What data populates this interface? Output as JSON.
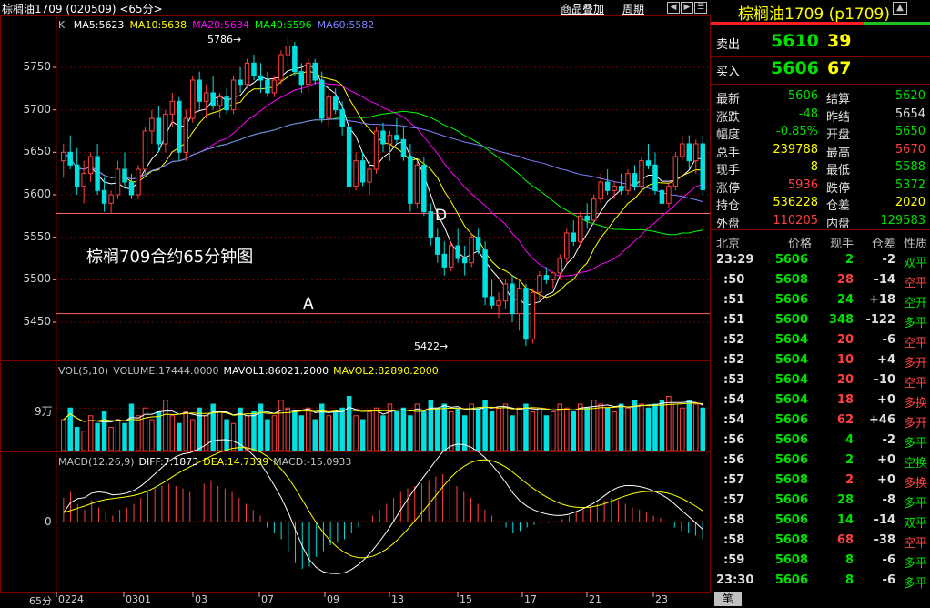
{
  "window": {
    "title": "棕榈油1709 (020509) <65分>",
    "menu_overlay": "商品叠加",
    "menu_period": "周期"
  },
  "main": {
    "k_label": "K",
    "ma_legend": [
      {
        "text": "MA5:5623",
        "color": "#ffffff"
      },
      {
        "text": "MA10:5638",
        "color": "#ffff00"
      },
      {
        "text": "MA20:5634",
        "color": "#ff00ff"
      },
      {
        "text": "MA40:5596",
        "color": "#00ff00"
      },
      {
        "text": "MA60:5582",
        "color": "#8080ff"
      }
    ],
    "annotation_title": "棕榈709合约65分钟图",
    "label_d": "D",
    "label_a": "A",
    "high_label": "5786",
    "low_label": "5422",
    "period_label": "65分"
  },
  "volume": {
    "legend": [
      {
        "text": "VOL(5,10)",
        "color": "#c0c0c0"
      },
      {
        "text": "VOLUME:17444.0000",
        "color": "#c0c0c0"
      },
      {
        "text": "MAVOL1:86021.2000",
        "color": "#ffffff"
      },
      {
        "text": "MAVOL2:82890.2000",
        "color": "#ffff00"
      }
    ],
    "axis_label": "9万"
  },
  "macd": {
    "legend": [
      {
        "text": "MACD(12,26,9)",
        "color": "#c0c0c0"
      },
      {
        "text": "DIFF:7.1873",
        "color": "#ffffff"
      },
      {
        "text": "DEA:14.7339",
        "color": "#ffff00"
      },
      {
        "text": "MACD:-15.0933",
        "color": "#c0c0c0"
      }
    ],
    "axis_label": "0"
  },
  "colors": {
    "up": "#ff4040",
    "down": "#00e0e0",
    "grid": "#800000",
    "hline": "#ff6060"
  },
  "chart_data": {
    "type": "candlestick",
    "y_axis": {
      "ticks": [
        "5750",
        "5700",
        "5650",
        "5600",
        "5550",
        "5500",
        "5450"
      ],
      "ylim": [
        5405,
        5810
      ]
    },
    "x_axis": {
      "ticks": [
        "0224",
        "0301",
        "03",
        "07",
        "09",
        "13",
        "15",
        "17",
        "21",
        "23"
      ]
    },
    "horizontal_lines": [
      5578,
      5460
    ],
    "candles": [
      [
        5640,
        5660,
        5620,
        5650
      ],
      [
        5650,
        5670,
        5630,
        5635
      ],
      [
        5635,
        5655,
        5600,
        5610
      ],
      [
        5610,
        5640,
        5590,
        5625
      ],
      [
        5625,
        5650,
        5615,
        5645
      ],
      [
        5645,
        5660,
        5600,
        5605
      ],
      [
        5605,
        5620,
        5580,
        5590
      ],
      [
        5590,
        5605,
        5578,
        5600
      ],
      [
        5600,
        5640,
        5595,
        5630
      ],
      [
        5630,
        5650,
        5610,
        5615
      ],
      [
        5615,
        5625,
        5595,
        5600
      ],
      [
        5600,
        5635,
        5595,
        5630
      ],
      [
        5630,
        5680,
        5625,
        5675
      ],
      [
        5675,
        5700,
        5660,
        5690
      ],
      [
        5690,
        5705,
        5650,
        5660
      ],
      [
        5660,
        5700,
        5650,
        5695
      ],
      [
        5695,
        5720,
        5680,
        5710
      ],
      [
        5710,
        5715,
        5640,
        5650
      ],
      [
        5650,
        5700,
        5640,
        5690
      ],
      [
        5690,
        5740,
        5685,
        5735
      ],
      [
        5735,
        5745,
        5700,
        5710
      ],
      [
        5710,
        5730,
        5690,
        5720
      ],
      [
        5720,
        5740,
        5700,
        5705
      ],
      [
        5705,
        5720,
        5690,
        5715
      ],
      [
        5715,
        5725,
        5695,
        5700
      ],
      [
        5700,
        5740,
        5695,
        5735
      ],
      [
        5735,
        5750,
        5720,
        5730
      ],
      [
        5730,
        5760,
        5725,
        5755
      ],
      [
        5755,
        5765,
        5735,
        5740
      ],
      [
        5740,
        5755,
        5720,
        5735
      ],
      [
        5735,
        5745,
        5715,
        5720
      ],
      [
        5720,
        5740,
        5715,
        5735
      ],
      [
        5735,
        5770,
        5730,
        5765
      ],
      [
        5765,
        5786,
        5750,
        5775
      ],
      [
        5775,
        5780,
        5740,
        5745
      ],
      [
        5745,
        5755,
        5720,
        5730
      ],
      [
        5730,
        5760,
        5720,
        5755
      ],
      [
        5755,
        5760,
        5730,
        5735
      ],
      [
        5735,
        5745,
        5685,
        5690
      ],
      [
        5690,
        5720,
        5680,
        5715
      ],
      [
        5715,
        5725,
        5695,
        5700
      ],
      [
        5700,
        5710,
        5670,
        5680
      ],
      [
        5680,
        5690,
        5600,
        5610
      ],
      [
        5610,
        5650,
        5605,
        5640
      ],
      [
        5640,
        5650,
        5610,
        5615
      ],
      [
        5615,
        5640,
        5600,
        5630
      ],
      [
        5630,
        5680,
        5625,
        5675
      ],
      [
        5675,
        5685,
        5650,
        5660
      ],
      [
        5660,
        5675,
        5640,
        5670
      ],
      [
        5670,
        5690,
        5660,
        5665
      ],
      [
        5665,
        5680,
        5640,
        5645
      ],
      [
        5645,
        5660,
        5580,
        5590
      ],
      [
        5590,
        5640,
        5585,
        5635
      ],
      [
        5635,
        5645,
        5575,
        5580
      ],
      [
        5580,
        5590,
        5540,
        5550
      ],
      [
        5550,
        5560,
        5520,
        5530
      ],
      [
        5530,
        5545,
        5505,
        5515
      ],
      [
        5515,
        5545,
        5510,
        5540
      ],
      [
        5540,
        5560,
        5520,
        5525
      ],
      [
        5525,
        5540,
        5505,
        5520
      ],
      [
        5520,
        5555,
        5515,
        5550
      ],
      [
        5550,
        5560,
        5530,
        5535
      ],
      [
        5535,
        5545,
        5470,
        5480
      ],
      [
        5480,
        5500,
        5465,
        5470
      ],
      [
        5470,
        5485,
        5455,
        5475
      ],
      [
        5475,
        5500,
        5465,
        5495
      ],
      [
        5495,
        5505,
        5450,
        5460
      ],
      [
        5460,
        5500,
        5440,
        5490
      ],
      [
        5490,
        5495,
        5422,
        5430
      ],
      [
        5430,
        5490,
        5425,
        5485
      ],
      [
        5485,
        5510,
        5475,
        5505
      ],
      [
        5505,
        5515,
        5495,
        5500
      ],
      [
        5500,
        5510,
        5490,
        5508
      ],
      [
        5508,
        5530,
        5500,
        5525
      ],
      [
        5525,
        5560,
        5520,
        5555
      ],
      [
        5555,
        5570,
        5540,
        5545
      ],
      [
        5545,
        5580,
        5540,
        5575
      ],
      [
        5575,
        5590,
        5560,
        5570
      ],
      [
        5570,
        5600,
        5565,
        5595
      ],
      [
        5595,
        5625,
        5590,
        5615
      ],
      [
        5615,
        5630,
        5600,
        5605
      ],
      [
        5605,
        5615,
        5595,
        5610
      ],
      [
        5610,
        5625,
        5600,
        5605
      ],
      [
        5605,
        5630,
        5600,
        5625
      ],
      [
        5625,
        5635,
        5605,
        5610
      ],
      [
        5610,
        5645,
        5605,
        5640
      ],
      [
        5640,
        5660,
        5630,
        5635
      ],
      [
        5635,
        5650,
        5600,
        5605
      ],
      [
        5605,
        5620,
        5580,
        5590
      ],
      [
        5590,
        5615,
        5585,
        5610
      ],
      [
        5610,
        5650,
        5605,
        5645
      ],
      [
        5645,
        5670,
        5640,
        5660
      ],
      [
        5660,
        5670,
        5630,
        5640
      ],
      [
        5640,
        5665,
        5625,
        5660
      ],
      [
        5660,
        5670,
        5600,
        5606
      ]
    ],
    "volume": [
      40,
      55,
      30,
      25,
      45,
      35,
      50,
      30,
      40,
      35,
      60,
      45,
      55,
      40,
      50,
      65,
      45,
      35,
      50,
      40,
      55,
      45,
      60,
      50,
      40,
      35,
      55,
      45,
      50,
      60,
      40,
      45,
      65,
      55,
      50,
      45,
      55,
      40,
      60,
      45,
      50,
      55,
      70,
      45,
      40,
      50,
      55,
      45,
      60,
      50,
      55,
      45,
      60,
      50,
      65,
      55,
      60,
      50,
      55,
      45,
      60,
      55,
      65,
      50,
      55,
      60,
      45,
      55,
      60,
      50,
      55,
      45,
      50,
      60,
      55,
      50,
      60,
      55,
      65,
      60,
      55,
      50,
      60,
      55,
      65,
      60,
      55,
      60,
      65,
      70,
      60,
      55,
      65,
      60,
      55,
      70,
      60,
      65,
      80,
      30
    ],
    "macd_hist": [
      20,
      25,
      15,
      10,
      18,
      12,
      8,
      5,
      10,
      12,
      15,
      20,
      25,
      28,
      30,
      32,
      30,
      28,
      25,
      30,
      32,
      35,
      30,
      28,
      25,
      20,
      15,
      10,
      5,
      -5,
      -10,
      -15,
      -25,
      -35,
      -40,
      -38,
      -30,
      -25,
      -20,
      -18,
      -15,
      -10,
      -5,
      0,
      5,
      10,
      15,
      20,
      25,
      28,
      30,
      32,
      35,
      38,
      40,
      35,
      30,
      25,
      20,
      15,
      10,
      5,
      0,
      -5,
      -10,
      -8,
      -5,
      -3,
      -2,
      -1,
      0,
      2,
      5,
      8,
      10,
      12,
      15,
      18,
      20,
      18,
      15,
      12,
      10,
      8,
      5,
      3,
      0,
      -5,
      -8,
      -10,
      -12,
      -15
    ],
    "series": [
      {
        "name": "MA5",
        "color": "#ffffff"
      },
      {
        "name": "MA10",
        "color": "#ffff00"
      },
      {
        "name": "MA20",
        "color": "#ff00ff"
      },
      {
        "name": "MA40",
        "color": "#00ff00"
      },
      {
        "name": "MA60",
        "color": "#8080ff"
      }
    ]
  },
  "quote": {
    "symbol_title": "棕榈油1709 (p1709)",
    "sell": {
      "label": "卖出",
      "price": "5610",
      "vol": "39"
    },
    "buy": {
      "label": "买入",
      "price": "5606",
      "vol": "67"
    },
    "rows": [
      {
        "l1": "最新",
        "v1": "5606",
        "c1": "green",
        "l2": "结算",
        "v2": "5620",
        "c2": "green"
      },
      {
        "l1": "涨跌",
        "v1": "-48",
        "c1": "green",
        "l2": "昨结",
        "v2": "5654",
        "c2": "white"
      },
      {
        "l1": "幅度",
        "v1": "-0.85%",
        "c1": "green",
        "l2": "开盘",
        "v2": "5650",
        "c2": "green"
      },
      {
        "l1": "总手",
        "v1": "239788",
        "c1": "yellow",
        "l2": "最高",
        "v2": "5670",
        "c2": "red"
      },
      {
        "l1": "现手",
        "v1": "8",
        "c1": "yellow",
        "l2": "最低",
        "v2": "5588",
        "c2": "green"
      },
      {
        "l1": "涨停",
        "v1": "5936",
        "c1": "red",
        "l2": "跌停",
        "v2": "5372",
        "c2": "green"
      },
      {
        "l1": "持仓",
        "v1": "536228",
        "c1": "yellow",
        "l2": "仓差",
        "v2": "2020",
        "c2": "yellow"
      },
      {
        "l1": "外盘",
        "v1": "110205",
        "c1": "red",
        "l2": "内盘",
        "v2": "129583",
        "c2": "green"
      }
    ],
    "ticks_header": [
      "北京",
      "价格",
      "现手",
      "仓差",
      "性质"
    ],
    "ticks": [
      {
        "time": "23:29",
        "price": "5606",
        "vol": "2",
        "oi": "-2",
        "nature": "双平",
        "vc": "green",
        "oc": "white",
        "nc": "green"
      },
      {
        "time": ":50",
        "price": "5608",
        "vol": "28",
        "oi": "-14",
        "nature": "空平",
        "vc": "red",
        "oc": "white",
        "nc": "red"
      },
      {
        "time": ":51",
        "price": "5606",
        "vol": "24",
        "oi": "+18",
        "nature": "空开",
        "vc": "green",
        "oc": "white",
        "nc": "green"
      },
      {
        "time": ":51",
        "price": "5600",
        "vol": "348",
        "oi": "-122",
        "nature": "多平",
        "vc": "green",
        "oc": "white",
        "nc": "green"
      },
      {
        "time": ":52",
        "price": "5604",
        "vol": "20",
        "oi": "-6",
        "nature": "空平",
        "vc": "red",
        "oc": "white",
        "nc": "red"
      },
      {
        "time": ":52",
        "price": "5604",
        "vol": "10",
        "oi": "+4",
        "nature": "多开",
        "vc": "red",
        "oc": "white",
        "nc": "red"
      },
      {
        "time": ":53",
        "price": "5604",
        "vol": "20",
        "oi": "-10",
        "nature": "空平",
        "vc": "red",
        "oc": "white",
        "nc": "red"
      },
      {
        "time": ":54",
        "price": "5604",
        "vol": "18",
        "oi": "+0",
        "nature": "多换",
        "vc": "red",
        "oc": "white",
        "nc": "red"
      },
      {
        "time": ":54",
        "price": "5606",
        "vol": "62",
        "oi": "+46",
        "nature": "多开",
        "vc": "red",
        "oc": "white",
        "nc": "red"
      },
      {
        "time": ":56",
        "price": "5606",
        "vol": "4",
        "oi": "-2",
        "nature": "多平",
        "vc": "green",
        "oc": "white",
        "nc": "green"
      },
      {
        "time": ":56",
        "price": "5606",
        "vol": "2",
        "oi": "+0",
        "nature": "空换",
        "vc": "green",
        "oc": "white",
        "nc": "green"
      },
      {
        "time": ":57",
        "price": "5608",
        "vol": "2",
        "oi": "+0",
        "nature": "多换",
        "vc": "red",
        "oc": "white",
        "nc": "red"
      },
      {
        "time": ":57",
        "price": "5606",
        "vol": "28",
        "oi": "-8",
        "nature": "多平",
        "vc": "green",
        "oc": "white",
        "nc": "green"
      },
      {
        "time": ":58",
        "price": "5606",
        "vol": "14",
        "oi": "-14",
        "nature": "双平",
        "vc": "green",
        "oc": "white",
        "nc": "green"
      },
      {
        "time": ":58",
        "price": "5608",
        "vol": "68",
        "oi": "-38",
        "nature": "空平",
        "vc": "red",
        "oc": "white",
        "nc": "red"
      },
      {
        "time": ":59",
        "price": "5608",
        "vol": "8",
        "oi": "-6",
        "nature": "多平",
        "vc": "green",
        "oc": "white",
        "nc": "green"
      },
      {
        "time": "23:30",
        "price": "5606",
        "vol": "8",
        "oi": "-6",
        "nature": "多平",
        "vc": "green",
        "oc": "white",
        "nc": "green"
      }
    ],
    "footer_tab": "笔"
  }
}
